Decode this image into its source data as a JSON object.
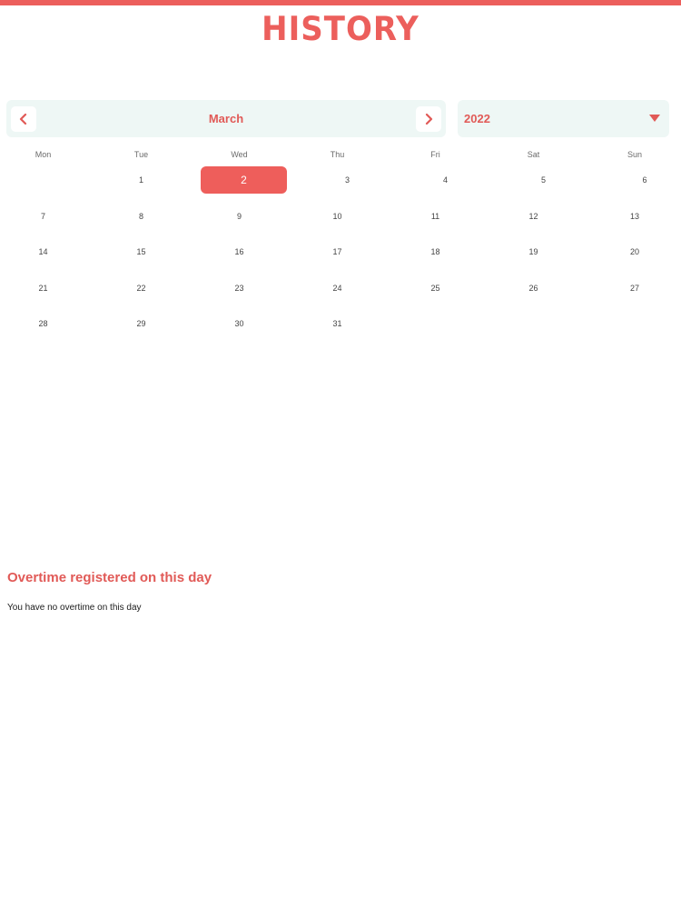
{
  "header": {
    "title": "HISTORY"
  },
  "calendar": {
    "month": "March",
    "year": "2022",
    "weekdays": [
      "Mon",
      "Tue",
      "Wed",
      "Thu",
      "Fri",
      "Sat",
      "Sun"
    ],
    "weeks": [
      [
        "",
        "1",
        "2",
        "3",
        "4",
        "5",
        "6"
      ],
      [
        "7",
        "8",
        "9",
        "10",
        "11",
        "12",
        "13"
      ],
      [
        "14",
        "15",
        "16",
        "17",
        "18",
        "19",
        "20"
      ],
      [
        "21",
        "22",
        "23",
        "24",
        "25",
        "26",
        "27"
      ],
      [
        "28",
        "29",
        "30",
        "31",
        "",
        "",
        ""
      ]
    ],
    "selected_day": "2"
  },
  "overtime": {
    "title": "Overtime registered on this day",
    "empty_message": "You have no overtime on this day"
  },
  "colors": {
    "accent": "#ec5f5c",
    "selector_bg": "#eef7f5"
  },
  "icons": {
    "prev": "chevron-left-icon",
    "next": "chevron-right-icon",
    "year_dropdown": "caret-down-icon"
  }
}
